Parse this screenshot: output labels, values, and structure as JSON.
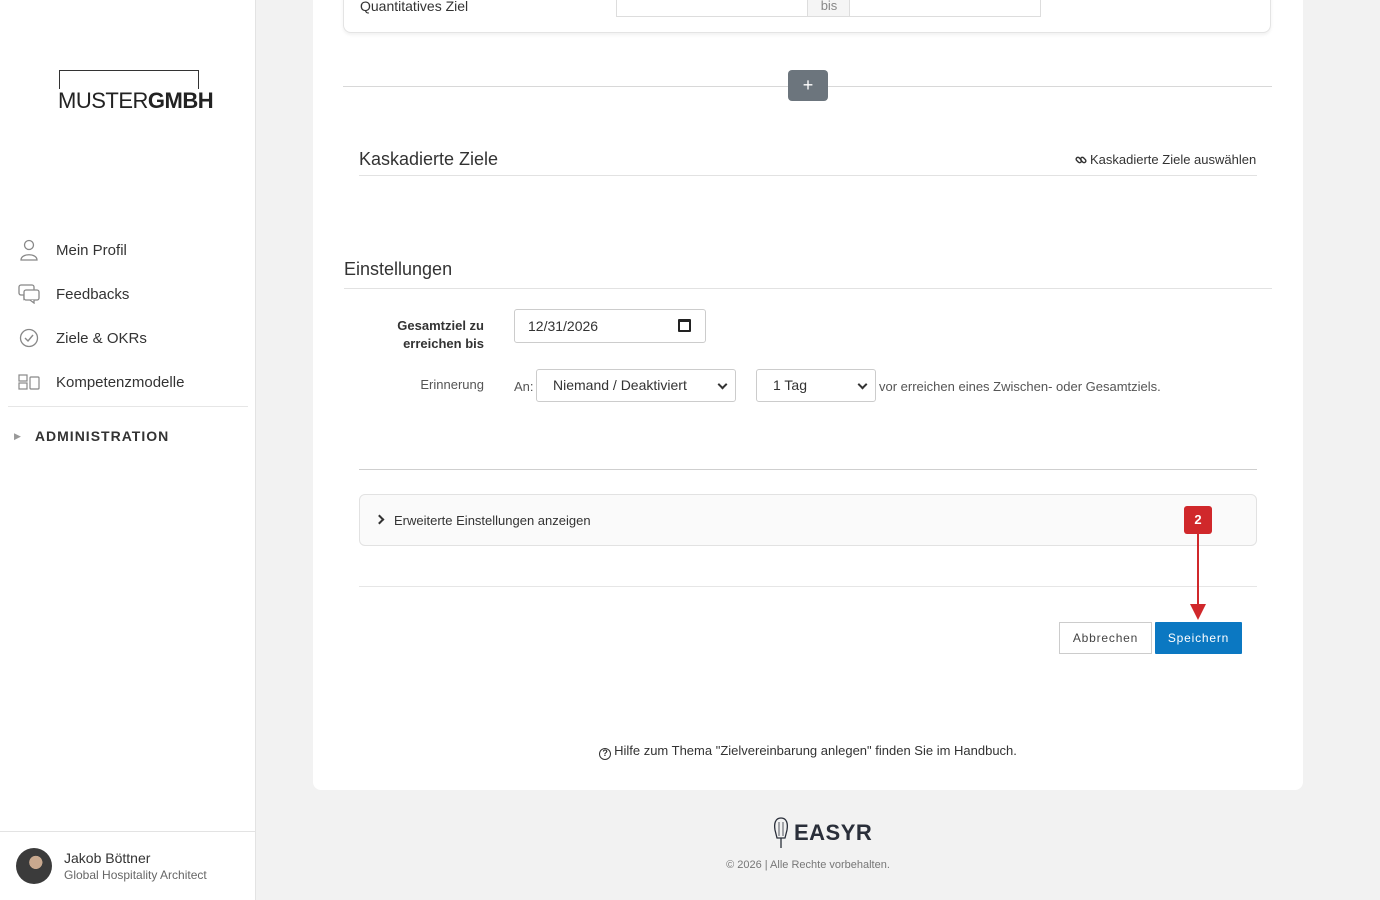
{
  "brand": {
    "logo_light": "MUSTER",
    "logo_bold": "GMBH"
  },
  "sidebar": {
    "items": [
      {
        "label": "Mein Profil",
        "icon": "user-icon"
      },
      {
        "label": "Feedbacks",
        "icon": "chat-bubbles-icon"
      },
      {
        "label": "Ziele & OKRs",
        "icon": "check-circle-icon"
      },
      {
        "label": "Kompetenzmodelle",
        "icon": "shapes-icon"
      }
    ],
    "admin_label": "ADMINISTRATION"
  },
  "user": {
    "name": "Jakob Böttner",
    "role": "Global Hospitality Architect"
  },
  "top_row": {
    "label": "Quantitatives Ziel",
    "separator": "bis"
  },
  "cascaded": {
    "title": "Kaskadierte Ziele",
    "link": "Kaskadierte Ziele auswählen"
  },
  "settings": {
    "title": "Einstellungen",
    "deadline_label": "Gesamtziel zu erreichen bis",
    "deadline_value": "12/31/2026",
    "reminder_label": "Erinnerung",
    "reminder_to_label": "An:",
    "reminder_to_value": "Niemand / Deaktiviert",
    "reminder_time_value": "1 Tag",
    "reminder_suffix": "vor erreichen eines Zwischen- oder Gesamtziels."
  },
  "advanced": {
    "label": "Erweiterte Einstellungen anzeigen"
  },
  "buttons": {
    "cancel": "Abbrechen",
    "save": "Speichern"
  },
  "annotation": {
    "badge": "2",
    "color": "#d0282b"
  },
  "help": {
    "text": "Hilfe zum Thema \"Zielvereinbarung anlegen\" finden Sie im Handbuch."
  },
  "footer": {
    "brand": "EASYR",
    "copyright": "© 2026 | Alle Rechte vorbehalten."
  },
  "colors": {
    "primary": "#0b78c2",
    "plus_button": "#6c757d"
  }
}
